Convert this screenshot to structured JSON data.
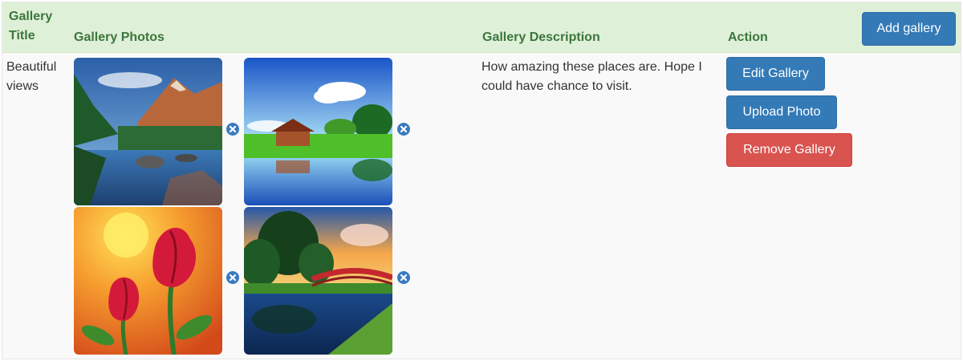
{
  "table": {
    "headers": {
      "title": "Gallery Title",
      "photos": "Gallery Photos",
      "description": "Gallery Description",
      "action": "Action"
    },
    "add_gallery_label": "Add gallery",
    "rows": [
      {
        "title": "Beautiful views",
        "description": "How amazing these places are. Hope I could have chance to visit.",
        "photos": [
          {
            "subject": "mountain lake with forest and reflection"
          },
          {
            "subject": "red cabin by green meadow reflected in water"
          },
          {
            "subject": "red roses with sun painting"
          },
          {
            "subject": "red bridge over pond at sunset"
          }
        ],
        "remove_photo_icon": "remove-circle-icon",
        "actions": {
          "edit": "Edit Gallery",
          "upload": "Upload Photo",
          "remove": "Remove Gallery"
        }
      }
    ]
  },
  "colors": {
    "header_bg": "#dff0d8",
    "header_text": "#3c763d",
    "primary": "#337ab7",
    "danger": "#d9534f"
  }
}
